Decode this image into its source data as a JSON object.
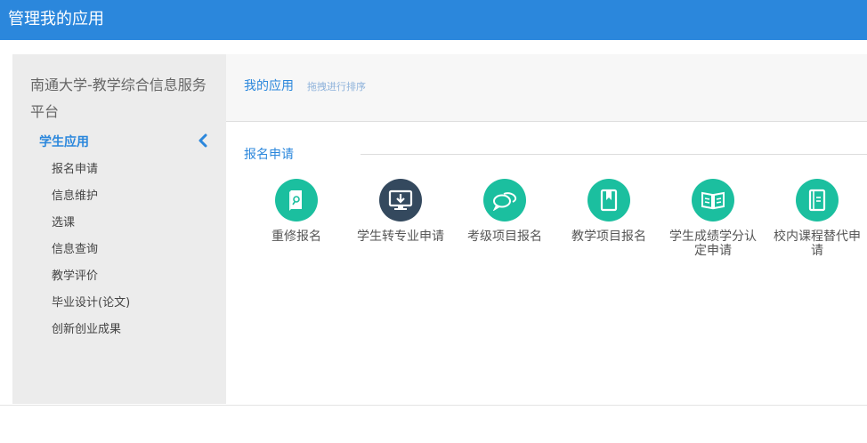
{
  "header": {
    "title": "管理我的应用"
  },
  "colors": {
    "brand": "#2b87dc",
    "teal": "#1bbf9f",
    "dark": "#34495e",
    "sidebar_bg": "#ececec"
  },
  "sidebar": {
    "site_title": "南通大学-教学综合信息服务平台",
    "group": {
      "label": "学生应用",
      "icon": "chevron-left-icon"
    },
    "items": [
      {
        "label": "报名申请"
      },
      {
        "label": "信息维护"
      },
      {
        "label": "选课"
      },
      {
        "label": "信息查询"
      },
      {
        "label": "教学评价"
      },
      {
        "label": "毕业设计(论文)"
      },
      {
        "label": "创新创业成果"
      }
    ]
  },
  "main": {
    "title": "我的应用",
    "hint": "拖拽进行排序",
    "section": {
      "label": "报名申请"
    },
    "apps": [
      {
        "label": "重修报名",
        "icon": "retake-book-icon",
        "color": "#1bbf9f"
      },
      {
        "label": "学生转专业申请",
        "icon": "monitor-download-icon",
        "color": "#34495e"
      },
      {
        "label": "考级项目报名",
        "icon": "chat-bubbles-icon",
        "color": "#1bbf9f"
      },
      {
        "label": "教学项目报名",
        "icon": "bookmark-book-icon",
        "color": "#1bbf9f"
      },
      {
        "label": "学生成绩学分认定申请",
        "icon": "open-book-icon",
        "color": "#1bbf9f"
      },
      {
        "label": "校内课程替代申请",
        "icon": "document-icon",
        "color": "#1bbf9f"
      }
    ]
  }
}
